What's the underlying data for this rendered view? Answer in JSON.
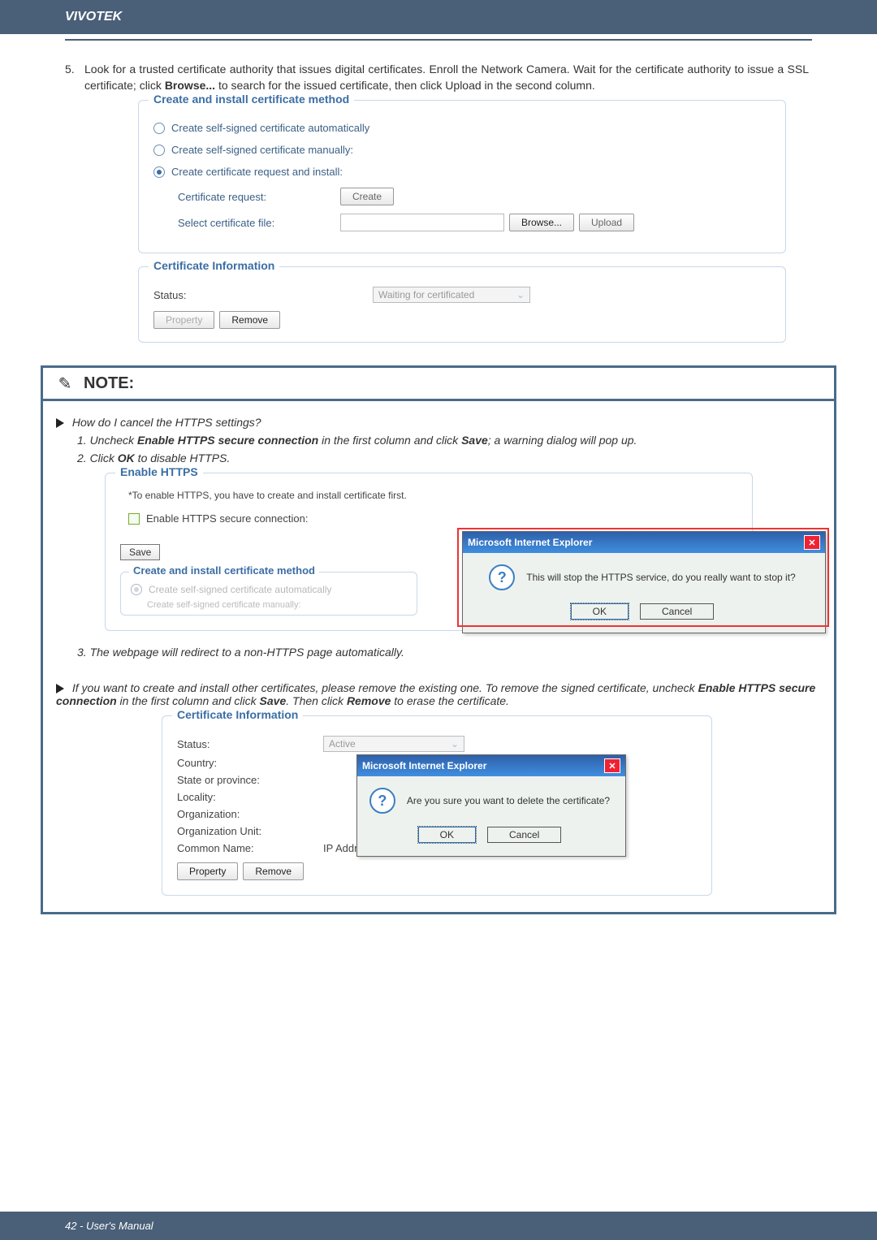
{
  "header": {
    "brand": "VIVOTEK"
  },
  "para1": {
    "num": "5.",
    "text_a": "Look for a trusted certificate authority that issues digital certificates. Enroll the Network Camera. Wait for the certificate authority to issue a SSL certificate; click ",
    "bold1": "Browse...",
    "text_b": " to search for the issued certificate, then click Upload in the second column."
  },
  "cert_method": {
    "legend": "Create and install certificate method",
    "opt1": "Create self-signed certificate automatically",
    "opt2": "Create self-signed certificate manually:",
    "opt3": "Create certificate request and install:",
    "req_label": "Certificate request:",
    "create_btn": "Create",
    "file_label": "Select certificate file:",
    "browse_btn": "Browse...",
    "upload_btn": "Upload"
  },
  "cert_info": {
    "legend": "Certificate Information",
    "status_label": "Status:",
    "status_value": "Waiting for certificated",
    "property_btn": "Property",
    "remove_btn": "Remove"
  },
  "note": {
    "title": "NOTE:",
    "q1": "How do I cancel the HTTPS settings?",
    "s1a": "1. Uncheck ",
    "s1b": "Enable HTTPS secure connection",
    "s1c": " in the first column and click ",
    "s1d": "Save",
    "s1e": "; a warning dialog will pop up.",
    "s2a": "2. Click ",
    "s2b": "OK",
    "s2c": " to disable HTTPS.",
    "enable": {
      "legend": "Enable HTTPS",
      "hint": "*To enable HTTPS, you have to create and install certificate first.",
      "chk_label": "Enable HTTPS secure connection:",
      "save": "Save",
      "method_legend": "Create and install certificate method",
      "m1": "Create self-signed certificate automatically",
      "m2": "Create self-signed certificate manually:"
    },
    "dialog1": {
      "title": "Microsoft Internet Explorer",
      "msg": "This will stop the HTTPS service, do you really want to stop it?",
      "ok": "OK",
      "cancel": "Cancel"
    },
    "s3": "3. The webpage will redirect to a non-HTTPS page automatically.",
    "q2a": "If you want to create and install other certificates, please remove the existing one. To remove the signed certificate, uncheck ",
    "q2b": "Enable HTTPS secure connection",
    "q2c": " in the first column and click ",
    "q2d": "Save",
    "q2e": ". Then click ",
    "q2f": "Remove",
    "q2g": " to erase the certificate.",
    "ci2": {
      "legend": "Certificate Information",
      "status": "Status:",
      "status_v": "Active",
      "country": "Country:",
      "state": "State or province:",
      "locality": "Locality:",
      "org": "Organization:",
      "orgunit": "Organization Unit:",
      "cn": "Common Name:",
      "cn_v": "IP Address",
      "property": "Property",
      "remove": "Remove"
    },
    "dialog2": {
      "title": "Microsoft Internet Explorer",
      "msg": "Are you sure you want to delete the certificate?",
      "ok": "OK",
      "cancel": "Cancel"
    }
  },
  "footer": "42 - User's Manual"
}
